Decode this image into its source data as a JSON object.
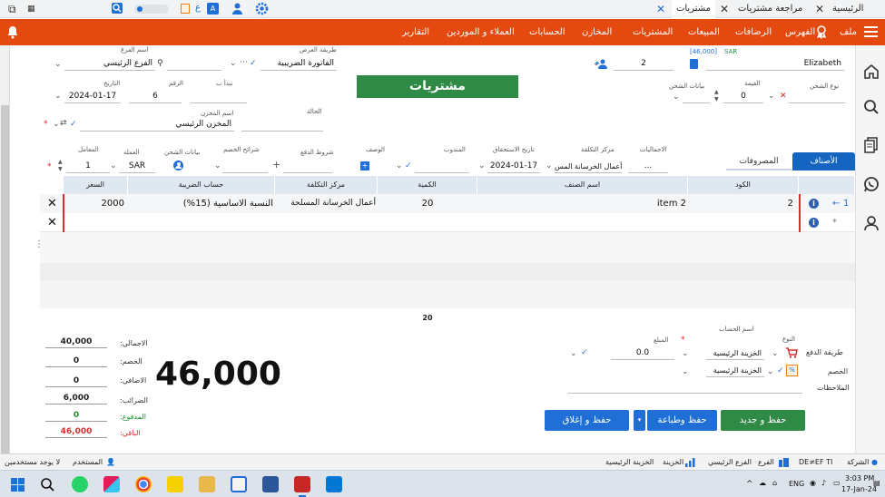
{
  "tabs": [
    {
      "label": "الرئيسية"
    },
    {
      "label": "مراجعة مشتريات"
    },
    {
      "label": "مشتريات"
    }
  ],
  "nav": {
    "items": [
      "ملف",
      "الفهرس",
      "الرضافات",
      "المبيعات",
      "المشتريات",
      "المخازن",
      "الحسابات",
      "العملاء و الموردين",
      "التقارير"
    ]
  },
  "header_top": {
    "branch_value": "الفرع الرئيسي",
    "display_method_value": "الفاتورة الضريبية",
    "currency_badge": "SAR",
    "amount_badge": "[46,000]",
    "customer_name": "Elizabeth",
    "number_value": "2"
  },
  "labels": {
    "branch": "اسم الفرع",
    "display_method": "طريقة العرض",
    "date": "التاريخ",
    "number": "الرقم",
    "starts": "تبدأ ب",
    "status": "الحالة",
    "store_name": "اسم المخزن",
    "shipping_data": "بيانات الشحن",
    "value": "القيمة",
    "shipping_type": "نوع الشحن",
    "totals": "الاجماليات",
    "cost_center": "مركز التكلفة",
    "due_date": "تاريخ الاستحقاق",
    "delegate": "المندوب",
    "description": "الوصف",
    "payment_terms": "شروط الدفع",
    "discount_tiers": "شرائح الخصم",
    "shipping_info": "بيانات الشحن",
    "currency": "العملة",
    "rate": "المعامل"
  },
  "form": {
    "date_value": "2024-01-17",
    "number_value": "6",
    "store_value": "المخزن الرئيسي",
    "value_amount": "0",
    "totals_value": "...",
    "cost_center_value": "أعمال الخرسانة المس",
    "due_date_value": "2024-01-17",
    "currency_value": "SAR",
    "rate_value": "1"
  },
  "title": "مشتريات",
  "subtabs": {
    "items": "الأصناف",
    "expenses": "المصروفات"
  },
  "grid": {
    "headers": [
      "الكود",
      "اسم الصنف",
      "الكمية",
      "مركز التكلفة",
      "حساب الضريبة",
      "السعر"
    ],
    "rows": [
      {
        "index": "1",
        "code": "2",
        "item_name": "item 2",
        "quantity": "20",
        "cost_center": "أعمال الخرسانة المسلحة",
        "tax_account": "النسبة الاساسية (15%)",
        "price": "2000"
      }
    ],
    "quantity_total": "20"
  },
  "totals": {
    "grand_total_big": "46,000",
    "total_label": "الاجمالي:",
    "total_value": "40,000",
    "discount_label": "الخصم:",
    "discount_value": "0",
    "additional_label": "الاضافي:",
    "additional_value": "0",
    "taxes_label": "الضرائب:",
    "taxes_value": "6,000",
    "paid_label": "المدفوع:",
    "paid_value": "0",
    "remaining_label": "الباقي:",
    "remaining_value": "46,000"
  },
  "payment": {
    "method_label": "طريقة الدفع",
    "discount_label": "الخصم",
    "notes_label": "الملاحظات",
    "type_header": "النوع",
    "account_header": "اسم الحساب",
    "amount_header": "المبلغ",
    "account_value": "الخزينة الرئيسية",
    "account_value2": "الخزينة الرئيسية",
    "amount_value": "0.0"
  },
  "buttons": {
    "save_new": "حفظ و جديد",
    "save_print": "حفظ وطباعة",
    "save_close": "حفظ و إغلاق"
  },
  "statusbar": {
    "company": "الشركة",
    "company_name": "DE≠EF TI",
    "branch": "الفرع",
    "branch_value": "الفرع الرئيسي",
    "treasury": "الخزينة",
    "treasury_value": "الخزينة الرئيسية",
    "user": "المستخدم",
    "user_value": "لا يوجد مستخدمين"
  },
  "taskbar": {
    "time": "3:03 PM",
    "date": "17-Jan-24",
    "lang": "ENG"
  },
  "colors": {
    "nav": "#e4490f",
    "title_banner": "#2e8a45",
    "primary_blue": "#1f6fd6",
    "tab_active": "#1565c0",
    "save_green": "#2e8a45",
    "paid_green": "#1d8f2c",
    "remaining_red": "#d32f2f"
  }
}
